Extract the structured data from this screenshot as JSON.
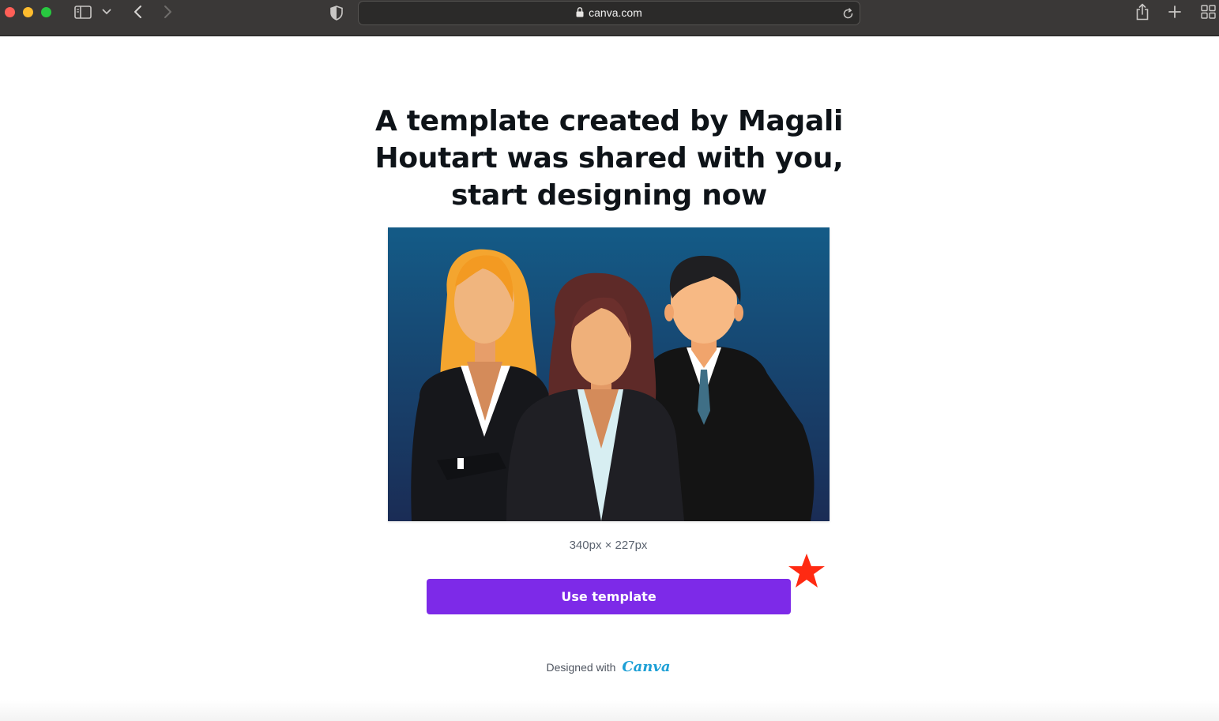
{
  "browser": {
    "url": "canva.com",
    "icons": [
      "sidebar-icon",
      "chevron-down-icon",
      "back-arrow-icon",
      "forward-arrow-icon",
      "shield-icon",
      "lock-icon",
      "reload-icon",
      "share-icon",
      "new-tab-icon",
      "tab-overview-icon"
    ]
  },
  "page": {
    "headline": "A template created by Magali Houtart was shared with you, start designing now",
    "dimensions": "340px × 227px",
    "use_template_label": "Use template",
    "designed_with": "Designed with",
    "brand": "Canva"
  },
  "colors": {
    "accent": "#7d2ae8",
    "star": "#ff2a12",
    "preview_bg_top": "#145b87",
    "preview_bg_bottom": "#1a2c55"
  }
}
